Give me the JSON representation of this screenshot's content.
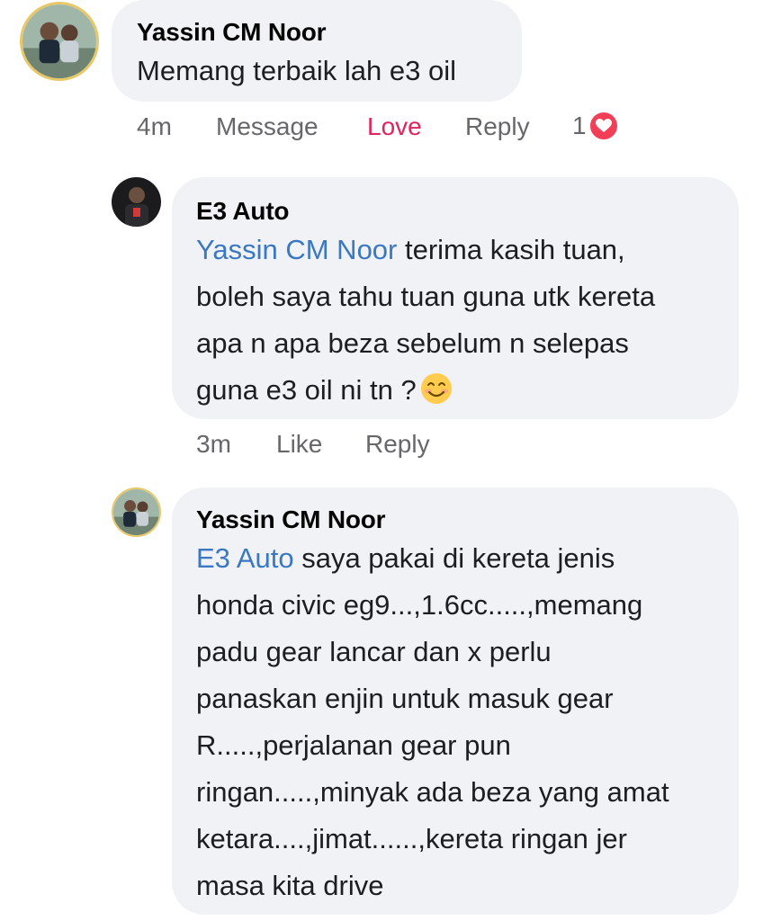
{
  "comments": [
    {
      "author": "Yassin CM Noor",
      "text": "Memang terbaik lah e3 oil",
      "time": "4m",
      "actions": [
        "Message",
        "Love",
        "Reply"
      ],
      "reaction_count": "1",
      "reaction_icon": "heart-icon",
      "accent_color": "#e0245e"
    },
    {
      "author": "E3 Auto",
      "mention": "Yassin CM Noor",
      "lines": [
        " terima kasih tuan,",
        "boleh saya tahu tuan guna utk kereta",
        "apa n apa beza sebelum n selepas",
        "guna e3 oil ni tn ?"
      ],
      "emoji": "smiling-face-icon",
      "time": "3m",
      "actions": [
        "Like",
        "Reply"
      ]
    },
    {
      "author": "Yassin CM Noor",
      "mention": "E3 Auto",
      "lines": [
        " saya pakai di kereta jenis",
        "honda civic eg9...,1.6cc.....,memang",
        "padu gear lancar dan x perlu",
        "panaskan enjin untuk masuk gear",
        "R.....,perjalanan gear pun",
        "ringan.....,minyak ada beza yang amat",
        "ketara....,jimat......,kereta ringan jer",
        "masa kita drive"
      ]
    }
  ],
  "colors": {
    "bubble": "#f0f2f5",
    "mention": "#3a78c3",
    "meta": "#65676b",
    "heart": "#f33e58"
  }
}
